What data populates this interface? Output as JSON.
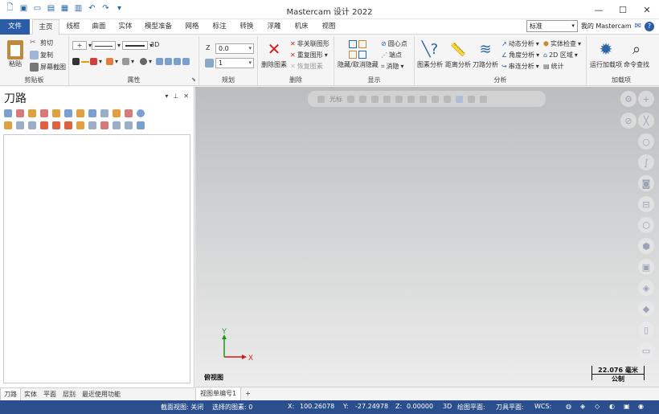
{
  "app": {
    "title": "Mastercam 设计 2022"
  },
  "tabs": [
    "文件",
    "主页",
    "线框",
    "曲面",
    "实体",
    "模型准备",
    "网格",
    "标注",
    "转换",
    "浮雕",
    "机床",
    "视图"
  ],
  "ribbon_right": {
    "dropdown": "标准",
    "my_label": "我的 Mastercam"
  },
  "groups": {
    "clipboard": {
      "label": "剪贴板",
      "paste": "粘贴",
      "cut": "剪切",
      "copy": "复制",
      "screenshot": "屏幕截图"
    },
    "attributes": {
      "label": "属性",
      "mode": "3D"
    },
    "plan": {
      "label": "规划",
      "z_label": "Z",
      "z_value": "0.0",
      "level_value": "1"
    },
    "delete": {
      "label": "删除",
      "delete_entity": "删除图素",
      "non_assoc": "非关联图形",
      "dup": "重复图形",
      "restore": "恢复图素"
    },
    "display": {
      "label": "显示",
      "hide": "隐藏/取消隐藏",
      "center": "圆心点",
      "endpoint": "端点",
      "blank": "消隐"
    },
    "analyze": {
      "label": "分析",
      "entity": "图素分析",
      "distance": "距离分析",
      "toolpath": "刀路分析",
      "dynamic": "动态分析",
      "angle": "角度分析",
      "chain": "串连分析",
      "solid": "实体检查",
      "area2d": "2D 区域",
      "stats": "统计"
    },
    "addins": {
      "label": "加载项",
      "run": "运行加载项",
      "cmd": "命令查找"
    }
  },
  "panel": {
    "title": "刀路",
    "bottom_tabs": [
      "刀路",
      "实体",
      "平面",
      "层别",
      "最近使用功能"
    ]
  },
  "viewport": {
    "toolbar_label": "光标",
    "view_name": "俯视图",
    "scale_value": "22.076 毫米",
    "scale_unit": "公制",
    "axis_x": "X",
    "axis_y": "Y",
    "tabs": [
      "视图单编号1",
      "+"
    ]
  },
  "status": {
    "section": "截面视图: 关闭",
    "selected": "选择的图素: 0",
    "x_label": "X:",
    "x": "100.26078",
    "y_label": "Y:",
    "y": "-27.24978",
    "z_label": "Z:",
    "z": "0.00000",
    "mode": "3D",
    "cplane": "绘图平面:",
    "tplane": "刀具平面:",
    "wcs": "WCS:"
  },
  "colors": {
    "accent": "#2a5ca8",
    "status": "#2a4f8c"
  }
}
